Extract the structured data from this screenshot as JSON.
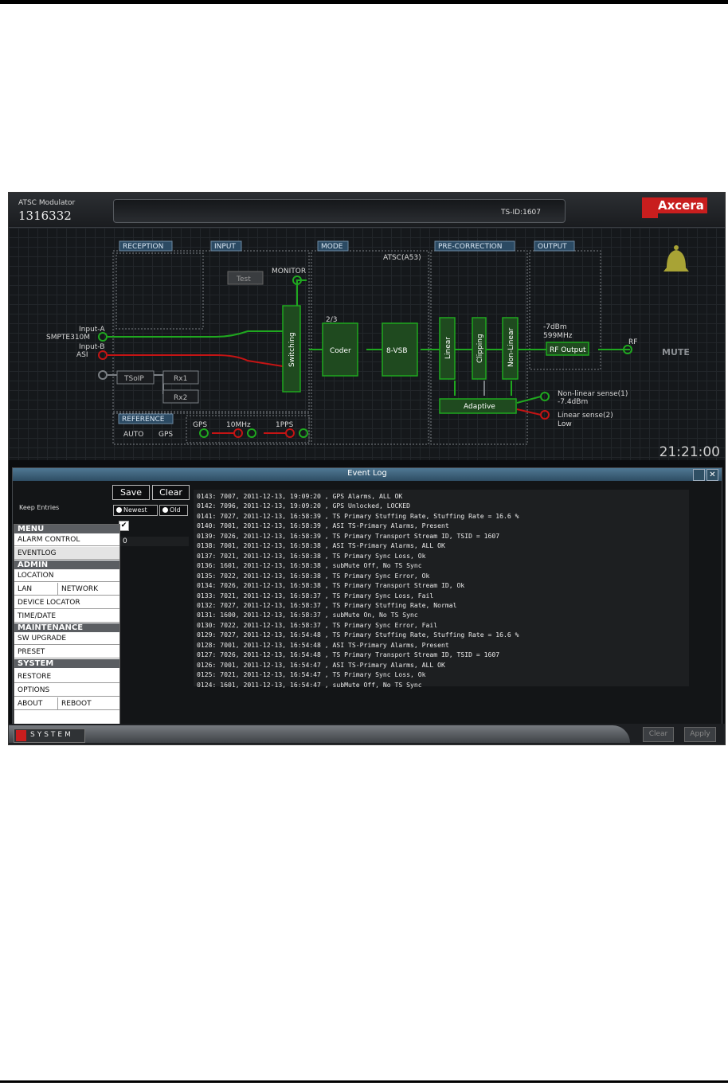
{
  "header": {
    "device_type": "ATSC Modulator",
    "serial": "1316332",
    "ts_id": "TS-ID:1607",
    "brand": "Axcera"
  },
  "diagram": {
    "sections": {
      "reception": "RECEPTION",
      "input": "INPUT",
      "mode": "MODE",
      "precorrection": "PRE-CORRECTION",
      "output": "OUTPUT",
      "reference": "REFERENCE"
    },
    "mode_value": "ATSC(A53)",
    "test_button": "Test",
    "monitor": "MONITOR",
    "input_a": "Input-A",
    "input_a_type": "SMPTE310M",
    "input_b": "Input-B",
    "input_b_type": "ASI",
    "tsoip": "TSoIP",
    "rx1": "Rx1",
    "rx2": "Rx2",
    "switching": "Switching",
    "rate": "2/3",
    "coder": "Coder",
    "vsb": "8-VSB",
    "linear": "Linear",
    "clipping": "Clipping",
    "nonlinear": "Non-Linear",
    "adaptive": "Adaptive",
    "power": "-7dBm",
    "freq": "599MHz",
    "rf_output": "RF Output",
    "rf": "RF",
    "mute": "MUTE",
    "nl_sense": "Non-linear sense(1)",
    "nl_sense_val": "-7.4dBm",
    "lin_sense": "Linear sense(2)",
    "lin_sense_val": "Low",
    "ref_mode": "AUTO",
    "ref_src": "GPS",
    "gps": "GPS",
    "tenmhz": "10MHz",
    "onepps": "1PPS",
    "clock": "21:21:00"
  },
  "eventlog": {
    "title": "Event Log",
    "save": "Save",
    "clear": "Clear",
    "keep_entries": "Keep Entries",
    "newest": "Newest",
    "old": "Old",
    "keep_value": "0",
    "entries": [
      "0143: 7007, 2011-12-13, 19:09:20 , GPS Alarms, ALL OK",
      "0142: 7096, 2011-12-13, 19:09:20 , GPS Unlocked, LOCKED",
      "0141: 7027, 2011-12-13, 16:58:39 , TS Primary Stuffing Rate, Stuffing Rate = 16.6 %",
      "0140: 7001, 2011-12-13, 16:58:39 , ASI TS-Primary Alarms, Present",
      "0139: 7026, 2011-12-13, 16:58:39 , TS Primary Transport Stream ID, TSID = 1607",
      "0138: 7001, 2011-12-13, 16:58:38 , ASI TS-Primary Alarms, ALL OK",
      "0137: 7021, 2011-12-13, 16:58:38 , TS Primary Sync Loss, Ok",
      "0136: 1601, 2011-12-13, 16:58:38 , subMute Off, No TS Sync",
      "0135: 7022, 2011-12-13, 16:58:38 , TS Primary Sync Error, Ok",
      "0134: 7026, 2011-12-13, 16:58:38 , TS Primary Transport Stream ID, Ok",
      "0133: 7021, 2011-12-13, 16:58:37 , TS Primary Sync Loss, Fail",
      "0132: 7027, 2011-12-13, 16:58:37 , TS Primary Stuffing Rate, Normal",
      "0131: 1600, 2011-12-13, 16:58:37 , subMute On, No TS Sync",
      "0130: 7022, 2011-12-13, 16:58:37 , TS Primary Sync Error, Fail",
      "0129: 7027, 2011-12-13, 16:54:48 , TS Primary Stuffing Rate, Stuffing Rate = 16.6 %",
      "0128: 7001, 2011-12-13, 16:54:48 , ASI TS-Primary Alarms, Present",
      "0127: 7026, 2011-12-13, 16:54:48 , TS Primary Transport Stream ID, TSID = 1607",
      "0126: 7001, 2011-12-13, 16:54:47 , ASI TS-Primary Alarms, ALL OK",
      "0125: 7021, 2011-12-13, 16:54:47 , TS Primary Sync Loss, Ok",
      "0124: 1601, 2011-12-13, 16:54:47 , subMute Off, No TS Sync"
    ]
  },
  "menu": {
    "menu_header": "MENU",
    "alarm_control": "ALARM CONTROL",
    "eventlog": "EVENTLOG",
    "admin_header": "ADMIN",
    "location": "LOCATION",
    "lan": "LAN",
    "network": "NETWORK",
    "device_locator": "DEVICE LOCATOR",
    "time_date": "TIME/DATE",
    "maintenance_header": "MAINTENANCE",
    "sw_upgrade": "SW UPGRADE",
    "preset": "PRESET",
    "system_header": "SYSTEM",
    "restore": "RESTORE",
    "options": "OPTIONS",
    "about": "ABOUT",
    "reboot": "REBOOT"
  },
  "footer": {
    "system": "SYSTEM",
    "clear": "Clear",
    "apply": "Apply"
  },
  "colors": {
    "green": "#1fa81f",
    "red": "#c41414",
    "panel": "#1f3a1f"
  }
}
